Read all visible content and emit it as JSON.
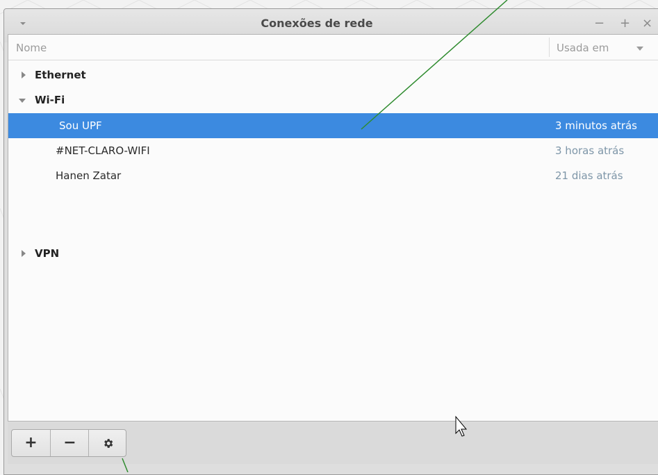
{
  "window": {
    "title": "Conexões de rede",
    "menu_icon": "chevron-down-icon",
    "controls": [
      "−",
      "+",
      "×"
    ]
  },
  "list": {
    "columns": {
      "name": "Nome",
      "used": "Usada em"
    },
    "groups": [
      {
        "label": "Ethernet",
        "expanded": false,
        "connections": []
      },
      {
        "label": "Wi-Fi",
        "expanded": true,
        "connections": [
          {
            "name": "Sou UPF",
            "used": "3 minutos atrás",
            "selected": true
          },
          {
            "name": "#NET-CLARO-WIFI",
            "used": "3 horas atrás",
            "selected": false
          },
          {
            "name": "Hanen Zatar",
            "used": "21 dias atrás",
            "selected": false
          }
        ]
      },
      {
        "label": "VPN",
        "expanded": false,
        "connections": []
      }
    ]
  },
  "toolbar": {
    "add_label": "+",
    "remove_label": "−",
    "settings_icon": "gear-icon"
  },
  "colors": {
    "selection": "#3c8ae0",
    "annotation_line": "#2e8b2e"
  }
}
